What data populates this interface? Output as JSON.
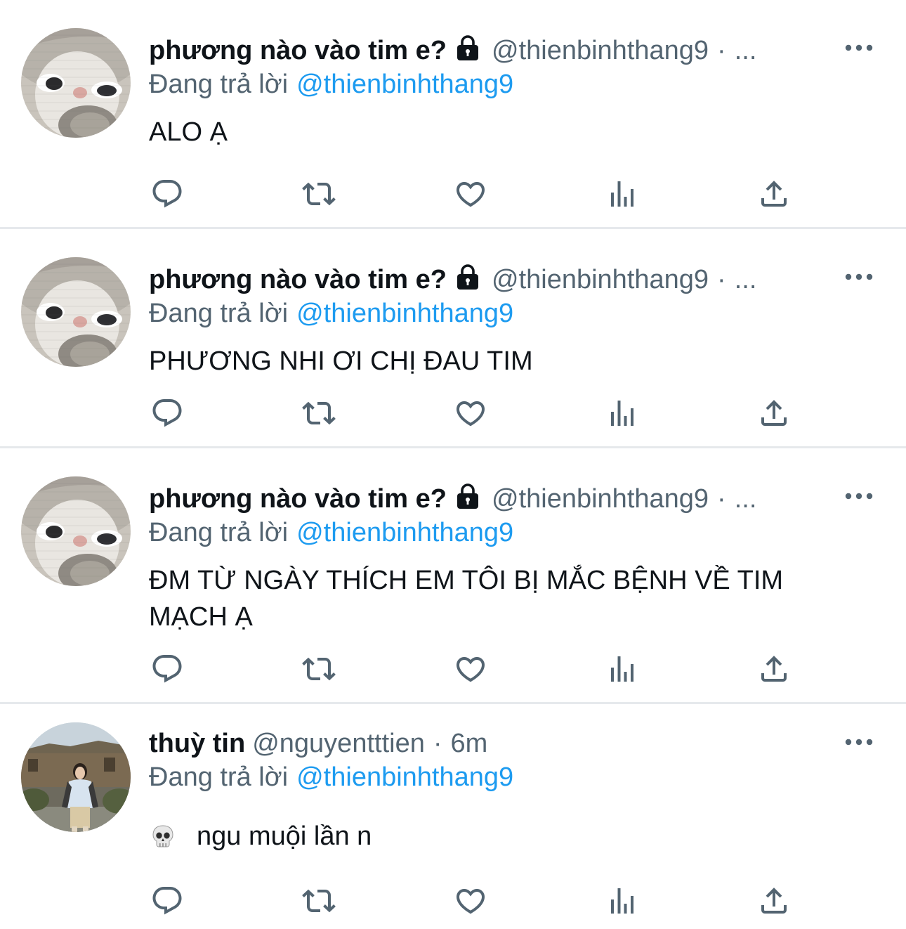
{
  "reply_prefix": "Đang trả lời",
  "tweets": [
    {
      "display_name": "phương nào vào tim e?",
      "handle": "@thienbinhthang9",
      "separator": "·",
      "time": "...",
      "reply_to": "@thienbinhthang9",
      "text": "ALO Ạ",
      "avatar": "cat-avatar",
      "protected": true
    },
    {
      "display_name": "phương nào vào tim e?",
      "handle": "@thienbinhthang9",
      "separator": "·",
      "time": "...",
      "reply_to": "@thienbinhthang9",
      "text": "PHƯƠNG NHI ƠI CHỊ ĐAU TIM",
      "avatar": "cat-avatar",
      "protected": true
    },
    {
      "display_name": "phương nào vào tim e?",
      "handle": "@thienbinhthang9",
      "separator": "·",
      "time": "...",
      "reply_to": "@thienbinhthang9",
      "text_line1": "ĐM TỪ NGÀY THÍCH EM TÔI BỊ MẮC BỆNH VỀ TIM",
      "text_line2": "MẠCH Ạ",
      "avatar": "cat-avatar",
      "protected": true
    },
    {
      "display_name": "thuỳ tin",
      "handle": "@nguyentttien",
      "separator": "·",
      "time": "6m",
      "reply_to": "@thienbinhthang9",
      "text": "ngu muội lần n",
      "emoji": "skull-emoji",
      "avatar": "photo-avatar",
      "protected": false
    }
  ],
  "action_icons": [
    "reply-icon",
    "retweet-icon",
    "like-icon",
    "views-icon",
    "share-icon"
  ],
  "colors": {
    "text": "#0f1419",
    "secondary": "#536471",
    "link": "#1d9bf0",
    "divider": "#e6e9ec",
    "icon": "#536471"
  }
}
